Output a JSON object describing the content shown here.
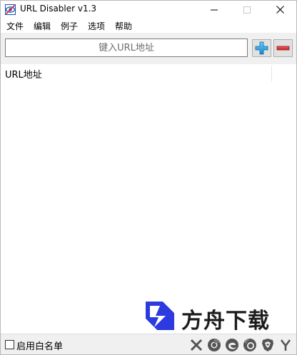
{
  "window": {
    "title": "URL Disabler v1.3"
  },
  "menu": {
    "items": [
      "文件",
      "编辑",
      "例子",
      "选项",
      "帮助"
    ]
  },
  "toolbar": {
    "url_placeholder": "键入URL地址",
    "url_value": ""
  },
  "list": {
    "column_header": "URL地址",
    "rows": []
  },
  "watermark": {
    "text": "方舟下载"
  },
  "status": {
    "whitelist_label": "启用白名单",
    "whitelist_checked": false,
    "browser_icons": [
      "close-x-icon",
      "chrome-icon",
      "edge-icon",
      "firefox-icon",
      "brave-icon",
      "yandex-icon"
    ]
  },
  "colors": {
    "add_accent": "#1e9be0",
    "remove_accent": "#d7262b",
    "toolbar_bg": "#f0f0f0"
  }
}
